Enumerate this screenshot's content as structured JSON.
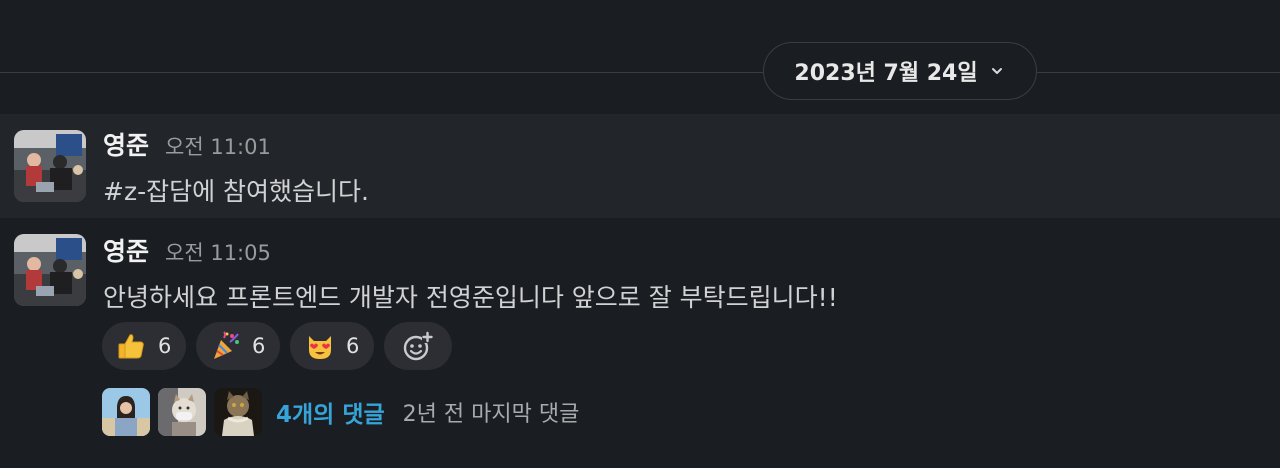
{
  "date_divider": {
    "label": "2023년 7월 24일",
    "chevron_icon": "chevron-down-icon"
  },
  "messages": [
    {
      "author": "영준",
      "time": "오전 11:01",
      "text": "#z-잡담에 참여했습니다."
    },
    {
      "author": "영준",
      "time": "오전 11:05",
      "text": "안녕하세요 프론트엔드 개발자 전영준입니다 앞으로 잘 부탁드립니다!!",
      "reactions": [
        {
          "emoji": "thumbs-up",
          "count": "6"
        },
        {
          "emoji": "party-popper",
          "count": "6"
        },
        {
          "emoji": "heart-eyes-cat",
          "count": "6"
        }
      ],
      "add_reaction_icon": "add-reaction-icon",
      "thread": {
        "reply_count_label": "4개의 댓글",
        "last_reply_label": "2년 전 마지막 댓글"
      }
    }
  ],
  "colors": {
    "background": "#1a1d21",
    "highlight_row": "#222529",
    "link": "#36a3d9"
  }
}
